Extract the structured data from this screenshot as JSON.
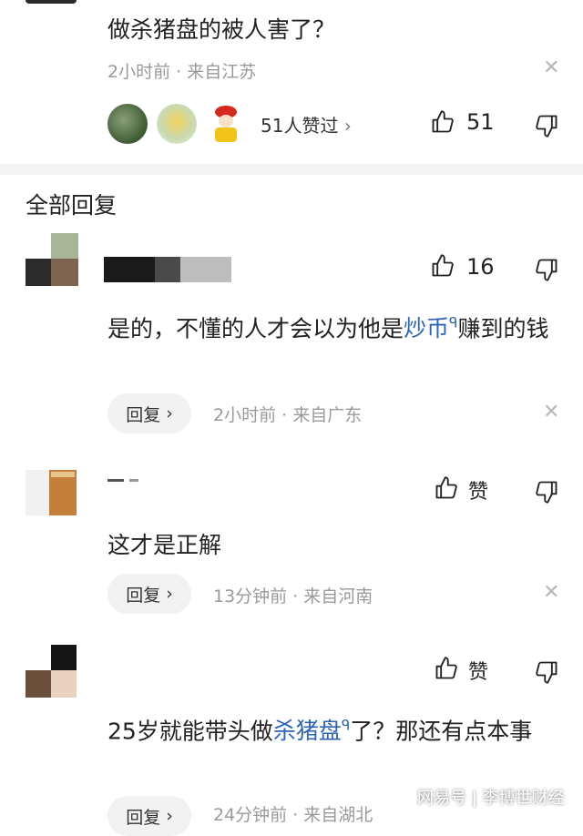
{
  "parent": {
    "text": "做杀猪盘的被人害了？",
    "meta": "2小时前 · 来自江苏",
    "likers_label": "51人赞过",
    "like_count": "51"
  },
  "section_title": "全部回复",
  "replies": [
    {
      "text_before_link": "是的，不懂的人才会以为他是",
      "link": "炒币",
      "text_after_link": "赚到的钱",
      "like": "16",
      "reply_label": "回复",
      "meta": "2小时前 · 来自广东"
    },
    {
      "text": "这才是正解",
      "like": "赞",
      "reply_label": "回复",
      "meta": "13分钟前 · 来自河南"
    },
    {
      "text_before_link": "25岁就能带头做",
      "link": "杀猪盘",
      "text_after_link": "了？那还有点本事",
      "like": "赞",
      "reply_label": "回复",
      "meta": "24分钟前 · 来自湖北"
    }
  ],
  "watermark": {
    "brand": "网易号",
    "author": "李博世财经"
  },
  "colors": {
    "link": "#2f64b3",
    "muted": "#9a9a9a"
  }
}
